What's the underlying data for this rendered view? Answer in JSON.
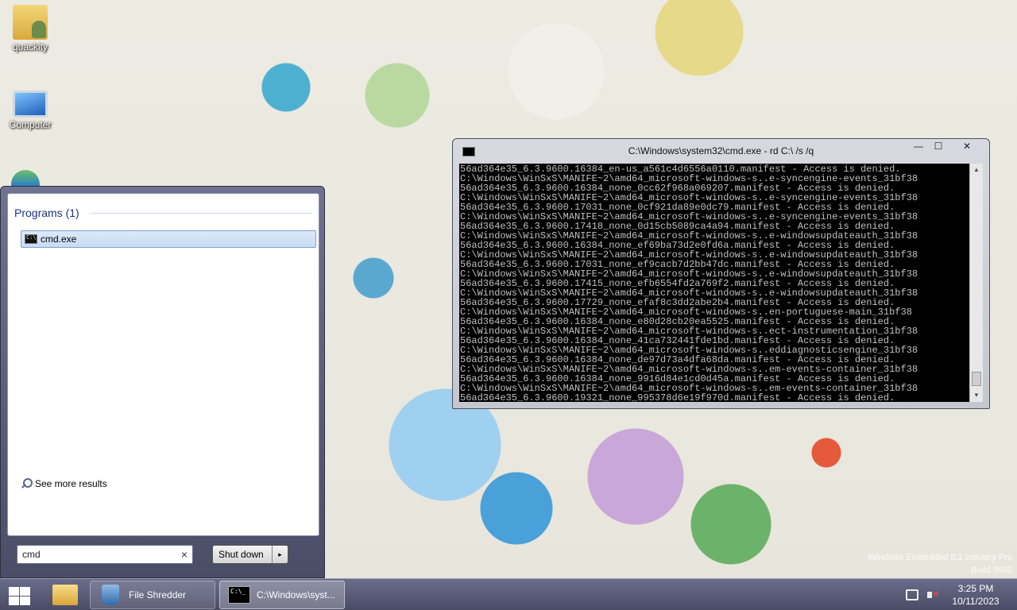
{
  "desktop": {
    "icons": [
      {
        "label": "quackity"
      },
      {
        "label": "Computer"
      }
    ],
    "watermark": {
      "line1": "Windows Embedded 8.1 Industry Pro",
      "line2": "Build 9600"
    }
  },
  "start_menu": {
    "programs_header": "Programs (1)",
    "results": [
      {
        "label": "cmd.exe",
        "icon": "cmd-icon"
      }
    ],
    "see_more": "See more results",
    "search": {
      "value": "cmd",
      "clear_icon": "×"
    },
    "shutdown_label": "Shut down",
    "shutdown_arrow": "▸"
  },
  "cmd_window": {
    "title": "C:\\Windows\\system32\\cmd.exe - rd  C:\\ /s /q",
    "buttons": {
      "minimize": "—",
      "maximize": "☐",
      "close": "✕"
    },
    "lines": [
      "56ad364e35_6.3.9600.16384_en-us_a561c4d6556a0110.manifest - Access is denied.",
      "C:\\Windows\\WinSxS\\MANIFE~2\\amd64_microsoft-windows-s..e-syncengine-events_31bf38",
      "56ad364e35_6.3.9600.16384_none_0cc62f968a069207.manifest - Access is denied.",
      "C:\\Windows\\WinSxS\\MANIFE~2\\amd64_microsoft-windows-s..e-syncengine-events_31bf38",
      "56ad364e35_6.3.9600.17031_none_0cf921da89e0dc79.manifest - Access is denied.",
      "C:\\Windows\\WinSxS\\MANIFE~2\\amd64_microsoft-windows-s..e-syncengine-events_31bf38",
      "56ad364e35_6.3.9600.17418_none_0d15cb5089ca4a94.manifest - Access is denied.",
      "C:\\Windows\\WinSxS\\MANIFE~2\\amd64_microsoft-windows-s..e-windowsupdateauth_31bf38",
      "56ad364e35_6.3.9600.16384_none_ef69ba73d2e0fd6a.manifest - Access is denied.",
      "C:\\Windows\\WinSxS\\MANIFE~2\\amd64_microsoft-windows-s..e-windowsupdateauth_31bf38",
      "56ad364e35_6.3.9600.17031_none_ef9cacb7d2bb47dc.manifest - Access is denied.",
      "C:\\Windows\\WinSxS\\MANIFE~2\\amd64_microsoft-windows-s..e-windowsupdateauth_31bf38",
      "56ad364e35_6.3.9600.17415_none_efb6554fd2a769f2.manifest - Access is denied.",
      "C:\\Windows\\WinSxS\\MANIFE~2\\amd64_microsoft-windows-s..e-windowsupdateauth_31bf38",
      "56ad364e35_6.3.9600.17729_none_efaf8c3dd2abe2b4.manifest - Access is denied.",
      "C:\\Windows\\WinSxS\\MANIFE~2\\amd64_microsoft-windows-s..en-portuguese-main_31bf38",
      "56ad364e35_6.3.9600.16384_none_e80d28cb20ea5525.manifest - Access is denied.",
      "C:\\Windows\\WinSxS\\MANIFE~2\\amd64_microsoft-windows-s..ect-instrumentation_31bf38",
      "56ad364e35_6.3.9600.16384_none_41ca732441fde1bd.manifest - Access is denied.",
      "C:\\Windows\\WinSxS\\MANIFE~2\\amd64_microsoft-windows-s..eddiagnosticsengine_31bf38",
      "56ad364e35_6.3.9600.16384_none_de97d73a4dfa68da.manifest - Access is denied.",
      "C:\\Windows\\WinSxS\\MANIFE~2\\amd64_microsoft-windows-s..em-events-container_31bf38",
      "56ad364e35_6.3.9600.16384_none_9916d84e1cd0d45a.manifest - Access is denied.",
      "C:\\Windows\\WinSxS\\MANIFE~2\\amd64_microsoft-windows-s..em-events-container_31bf38",
      "56ad364e35_6.3.9600.19321_none_995378d6e19f970d.manifest - Access is denied."
    ]
  },
  "taskbar": {
    "items": [
      {
        "label": "File Shredder"
      },
      {
        "label": "C:\\Windows\\syst..."
      }
    ],
    "clock": {
      "time": "3:25 PM",
      "date": "10/11/2023"
    }
  }
}
